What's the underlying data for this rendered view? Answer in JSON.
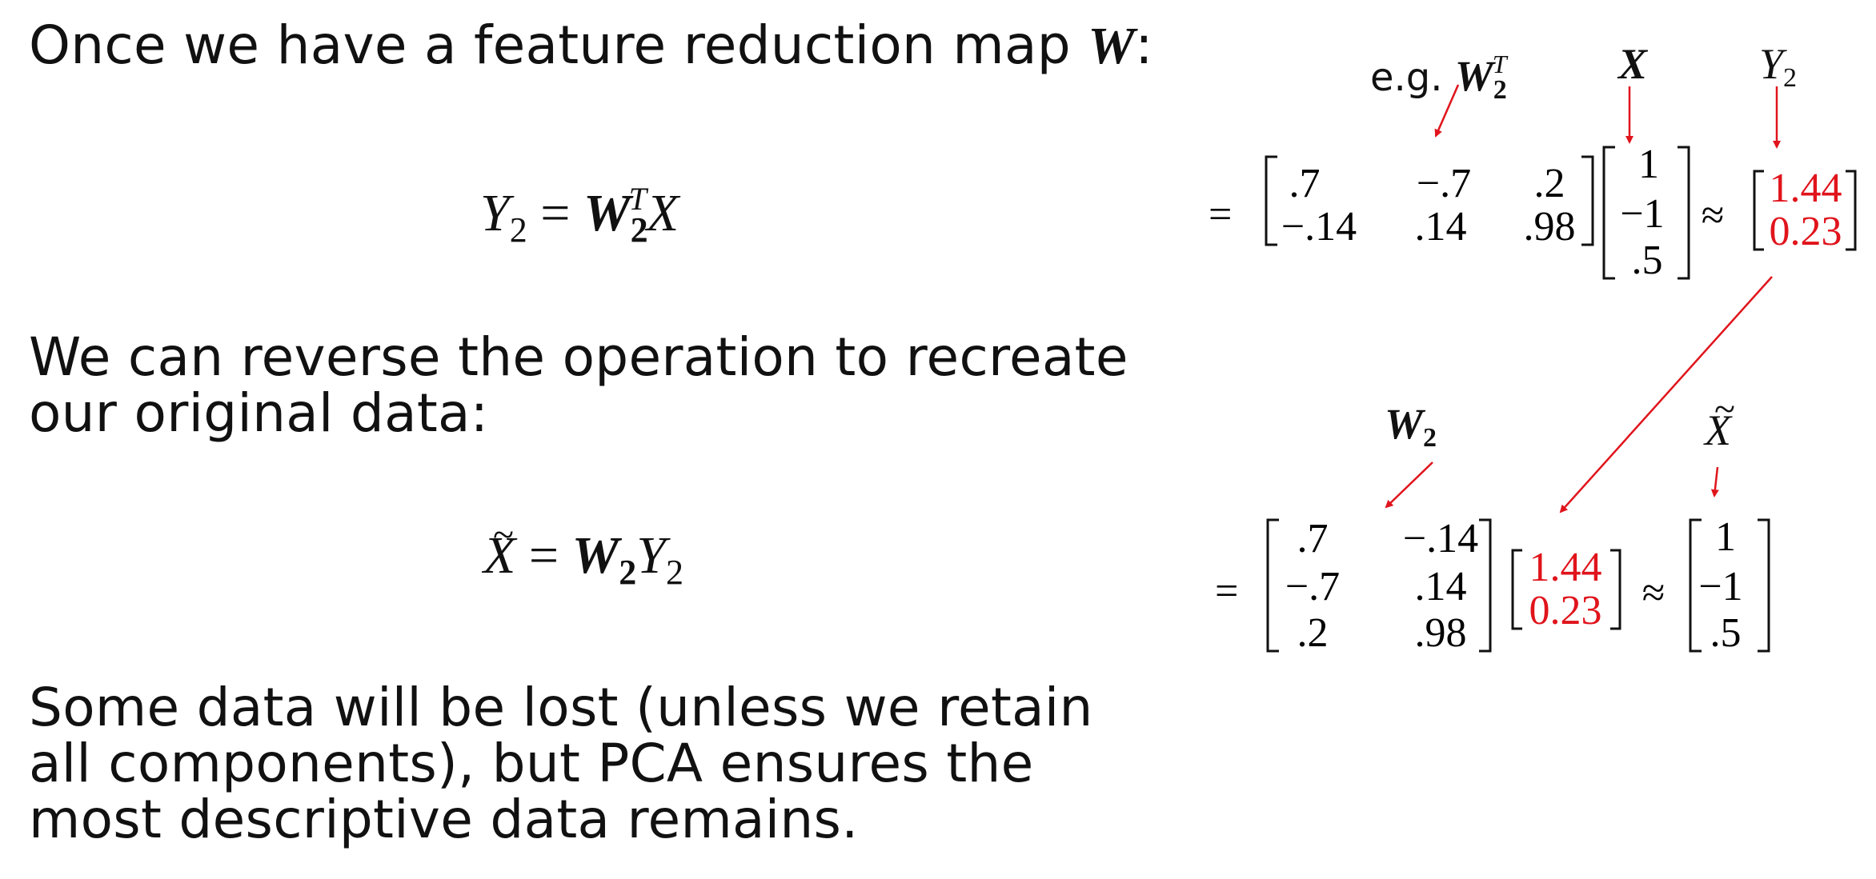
{
  "text": {
    "line1": "Once we have a feature reduction map ",
    "line1_symbol": "W",
    "line1_colon": ":",
    "para2": [
      "We can reverse the operation to recreate",
      "our original data:"
    ],
    "para3": [
      "Some data will be lost (unless we retain",
      "all components), but PCA ensures the",
      "most descriptive data remains."
    ]
  },
  "equation1": {
    "lhs": "Y",
    "lhs_sub": "2",
    "eq": "=",
    "W": "W",
    "W_sub": "2",
    "W_sup": "T",
    "rhs": "X"
  },
  "equation2": {
    "lhs": "X",
    "eq": "=",
    "W": "W",
    "W_sub": "2",
    "Y": "Y",
    "Y_sub": "2"
  },
  "labels": {
    "eg_prefix": "e.g. ",
    "eg_W": "W",
    "eg_W_sub": "2",
    "eg_W_sup": "T",
    "X": "X",
    "Y2": "Y",
    "Y2_sub": "2",
    "W2": "W",
    "W2_sub": "2",
    "Xtilde": "X"
  },
  "matrix1": {
    "eq": "=",
    "W": [
      [
        ".7",
        "−.7",
        ".2"
      ],
      [
        "−.14",
        ".14",
        ".98"
      ]
    ],
    "X": [
      "1",
      "−1",
      ".5"
    ],
    "approx": "≈",
    "Y": [
      "1.44",
      "0.23"
    ]
  },
  "matrix2": {
    "eq": "=",
    "W": [
      [
        ".7",
        "−.14"
      ],
      [
        "−.7",
        ".14"
      ],
      [
        ".2",
        ".98"
      ]
    ],
    "Y": [
      "1.44",
      "0.23"
    ],
    "approx": "≈",
    "X": [
      "1",
      "−1",
      ".5"
    ]
  },
  "colors": {
    "highlight": "#e0141c",
    "text": "#111111"
  }
}
